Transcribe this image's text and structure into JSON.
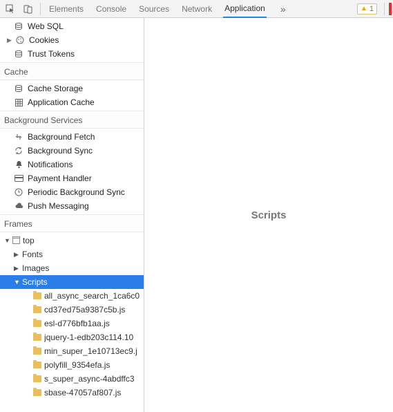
{
  "toolbar": {
    "tabs": [
      "Elements",
      "Console",
      "Sources",
      "Network",
      "Application"
    ],
    "active_tab": 4,
    "warning_count": "1"
  },
  "sidebar": {
    "storage_tail": [
      {
        "label": "Web SQL",
        "icon": "db"
      },
      {
        "label": "Cookies",
        "icon": "cookie",
        "expandable": true
      },
      {
        "label": "Trust Tokens",
        "icon": "db"
      }
    ],
    "sections": [
      {
        "title": "Cache",
        "items": [
          {
            "label": "Cache Storage",
            "icon": "db"
          },
          {
            "label": "Application Cache",
            "icon": "grid"
          }
        ]
      },
      {
        "title": "Background Services",
        "items": [
          {
            "label": "Background Fetch",
            "icon": "fetch"
          },
          {
            "label": "Background Sync",
            "icon": "sync"
          },
          {
            "label": "Notifications",
            "icon": "bell"
          },
          {
            "label": "Payment Handler",
            "icon": "card"
          },
          {
            "label": "Periodic Background Sync",
            "icon": "clock"
          },
          {
            "label": "Push Messaging",
            "icon": "cloud"
          }
        ]
      }
    ],
    "frames": {
      "title": "Frames",
      "top_label": "top",
      "folders": [
        {
          "label": "Fonts",
          "open": false
        },
        {
          "label": "Images",
          "open": false
        },
        {
          "label": "Scripts",
          "open": true,
          "selected": true
        }
      ],
      "scripts": [
        "all_async_search_1ca6c0",
        "cd37ed75a9387c5b.js",
        "esl-d776bfb1aa.js",
        "jquery-1-edb203c114.10",
        "min_super_1e10713ec9.j",
        "polyfill_9354efa.js",
        "s_super_async-4abdffc3",
        "sbase-47057af807.js"
      ]
    }
  },
  "content": {
    "title": "Scripts"
  },
  "icons": {
    "db": "≡",
    "cookie": "◔",
    "grid": "▦",
    "fetch": "↕",
    "sync": "↻",
    "bell": "🔔",
    "card": "▭",
    "clock": "◷",
    "cloud": "☁"
  }
}
